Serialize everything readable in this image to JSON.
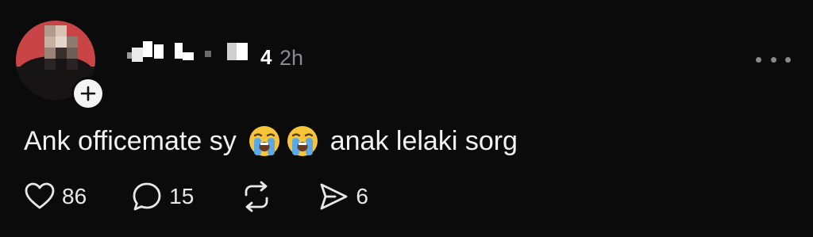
{
  "post": {
    "time": "2h",
    "content_before": "Ank officemate sy",
    "content_after": "anak lelaki sorg",
    "emoji": [
      "loudly-crying-face",
      "loudly-crying-face"
    ],
    "username_visible_char": "4"
  },
  "actions": {
    "likes": "86",
    "comments": "15",
    "shares": "6"
  },
  "icons": {
    "like": "heart-icon",
    "comment": "speech-bubble-icon",
    "repost": "repost-icon",
    "share": "send-icon",
    "more": "more-dots-icon",
    "follow": "plus-icon"
  },
  "colors": {
    "background": "#0b0b0c",
    "text": "#f3f3f3",
    "muted": "#8a8a8e"
  }
}
